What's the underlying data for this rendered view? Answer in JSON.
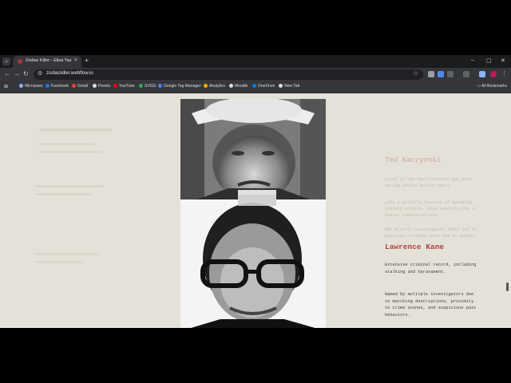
{
  "tab": {
    "title": "Zodiac Killer - Elisa Yaz",
    "close": "×",
    "new": "+"
  },
  "window_controls": {
    "minimize": "–",
    "maximize": "▢",
    "close": "✕"
  },
  "toolbar": {
    "back": "←",
    "forward": "→",
    "reload": "↻",
    "url": "zodiackiller.webflow.io",
    "star": "☆"
  },
  "bookmarks": [
    {
      "label": "Micropass",
      "color": "#8ab4f8"
    },
    {
      "label": "Facebook",
      "color": "#1877f2"
    },
    {
      "label": "Gmail",
      "color": "#ea4335"
    },
    {
      "label": "Pexels",
      "color": "#dddddd"
    },
    {
      "label": "YouTube",
      "color": "#ff0000"
    },
    {
      "label": "SVGG",
      "color": "#34a853"
    },
    {
      "label": "Google Tag Manager",
      "color": "#4285f4"
    },
    {
      "label": "Analytics",
      "color": "#f9ab00"
    },
    {
      "label": "Moodle",
      "color": "#dddddd"
    },
    {
      "label": "OneDrive",
      "color": "#0f78d4"
    },
    {
      "label": "New Tab",
      "color": "#dddddd"
    }
  ],
  "all_bookmarks": "All Bookmarks",
  "suspects": {
    "faded": {
      "name": "Ted Kaczynski",
      "p1": "Lived in the San Francisco Bay Area during Zodiac active years.",
      "p2": "Left a prolific history of managing violent attacks, plus similarities to Zodiac communications.",
      "p3": "FBI briefly investigated links but no physical evidence tied him to Zodiac."
    },
    "main": {
      "name": "Lawrence Kane",
      "p1": "Extensive criminal record, including stalking and harassment.",
      "p2": "Named by multiple investigators due to matching descriptions, proximity to crime scenes, and suspicious past behaviors."
    }
  }
}
